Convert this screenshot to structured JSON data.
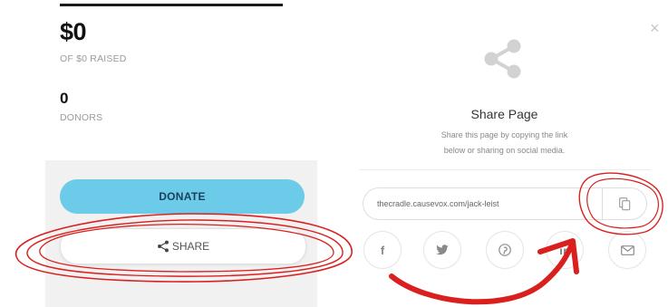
{
  "campaign": {
    "amount_raised": "$0",
    "raised_label": "OF $0 RAISED",
    "donors_count": "0",
    "donors_label": "DONORS",
    "donate_label": "DONATE",
    "share_label": "SHARE"
  },
  "share_modal": {
    "close_glyph": "×",
    "title": "Share Page",
    "description_line1": "Share this page by copying the link",
    "description_line2": "below or sharing on social media.",
    "link_value": "thecradle.causevox.com/jack-leist",
    "copy_icon": "copy-icon",
    "social_buttons": [
      {
        "name": "facebook",
        "glyph": "f"
      },
      {
        "name": "twitter",
        "glyph": "twitter-bird-icon"
      },
      {
        "name": "pinterest",
        "glyph": "pinterest-icon"
      },
      {
        "name": "linkedin",
        "glyph": "linkedin-icon"
      },
      {
        "name": "email",
        "glyph": "envelope-icon"
      }
    ]
  },
  "colors": {
    "donate_button": "#6ccbe9",
    "annotation_red": "#d9201f",
    "panel_gray": "#f1f1f1"
  }
}
